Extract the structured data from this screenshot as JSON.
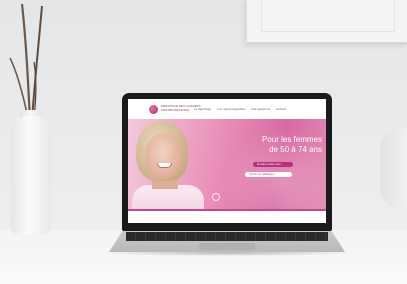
{
  "scene": {
    "description_objects": [
      "laptop",
      "vase-with-branches",
      "picture-frame",
      "round-vase"
    ]
  },
  "website": {
    "logo_line1": "DÉPISTAGE DES CANCERS",
    "logo_line2": "CENTRE RÉGIONAL",
    "nav": [
      "Le dépistage",
      "Les mammographies",
      "Vos questions",
      "Contact"
    ],
    "hero_title_line1": "Pour les femmes",
    "hero_title_line2": "de 50 à 74 ans",
    "button_primary": "Prendre rendez-vous ›",
    "button_secondary": "Trouver un radiologue ›"
  }
}
